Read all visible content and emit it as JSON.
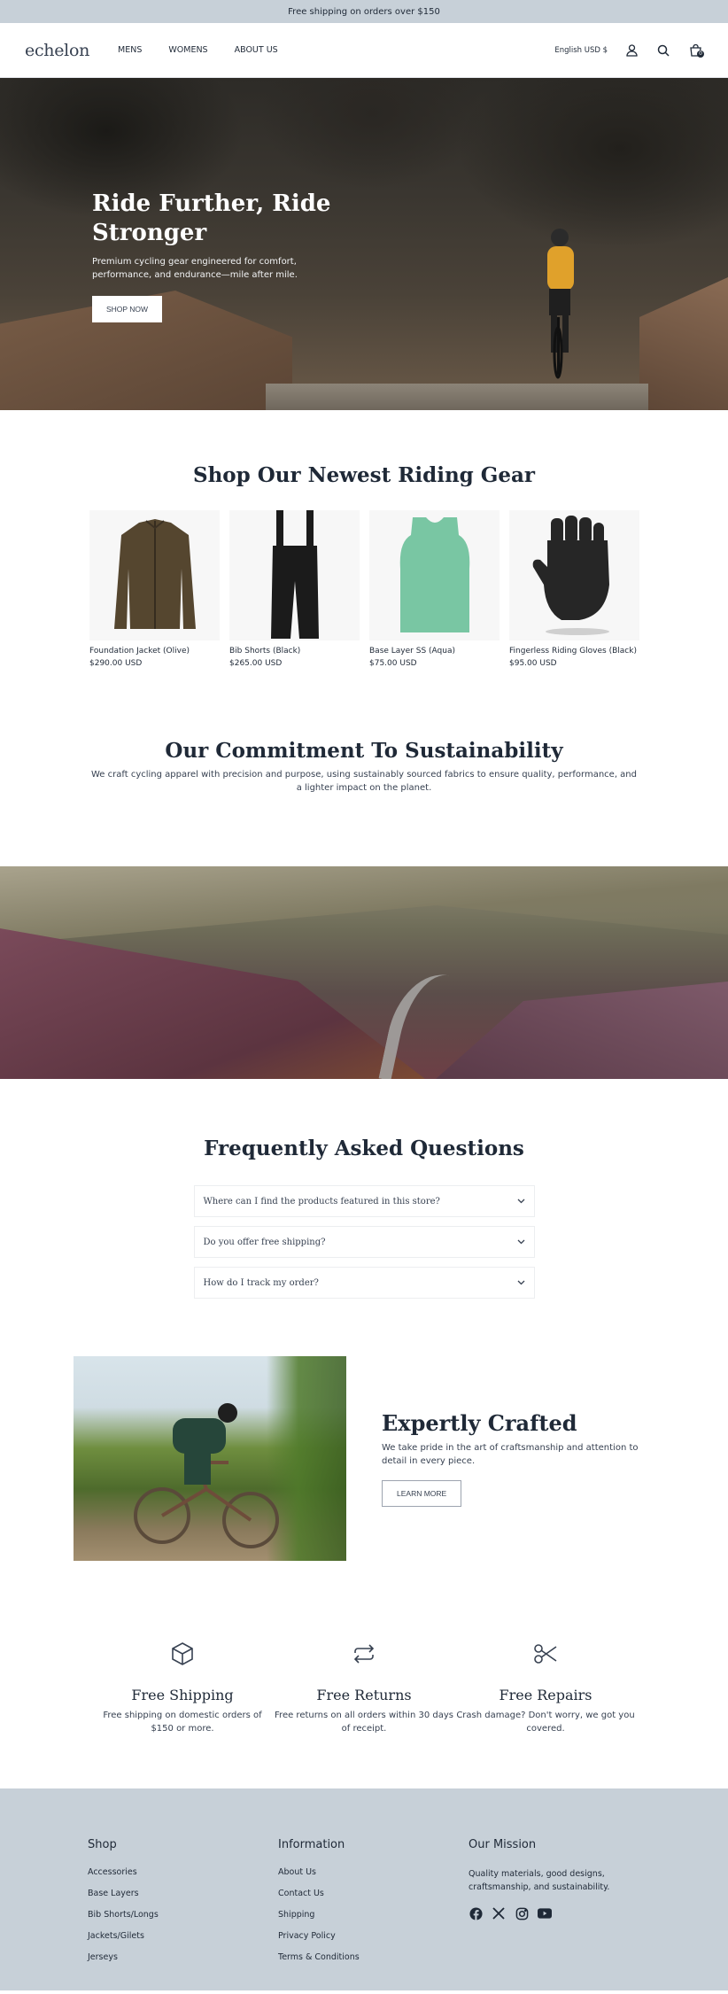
{
  "announcement": "Free shipping on orders over $150",
  "header": {
    "logo": "echelon",
    "nav": [
      "MENS",
      "WOMENS",
      "ABOUT US"
    ],
    "locale": "English USD $",
    "cart_count": "0"
  },
  "hero": {
    "title": "Ride Further, Ride Stronger",
    "subtitle": "Premium cycling gear engineered for comfort, performance, and endurance—mile after mile.",
    "button": "SHOP NOW"
  },
  "products": {
    "title": "Shop Our Newest Riding Gear",
    "items": [
      {
        "name": "Foundation Jacket (Olive)",
        "price": "$290.00 USD",
        "color": "#55462f"
      },
      {
        "name": "Bib Shorts (Black)",
        "price": "$265.00 USD",
        "color": "#1b1b1b"
      },
      {
        "name": "Base Layer SS (Aqua)",
        "price": "$75.00 USD",
        "color": "#79c6a3"
      },
      {
        "name": "Fingerless Riding Gloves (Black)",
        "price": "$95.00 USD",
        "color": "#262626"
      }
    ]
  },
  "sustainability": {
    "title": "Our Commitment To Sustainability",
    "text": "We craft cycling apparel with precision and purpose, using sustainably sourced fabrics to ensure quality, performance, and a lighter impact on the planet."
  },
  "faq": {
    "title": "Frequently Asked Questions",
    "items": [
      "Where can I find the products featured in this store?",
      "Do you offer free shipping?",
      "How do I track my order?"
    ]
  },
  "crafted": {
    "title": "Expertly Crafted",
    "text": "We take pride in the art of craftsmanship and attention to detail in every piece.",
    "button": "LEARN MORE"
  },
  "features": [
    {
      "icon": "box-icon",
      "title": "Free Shipping",
      "text": "Free shipping on domestic orders of $150 or more."
    },
    {
      "icon": "repeat-icon",
      "title": "Free Returns",
      "text": "Free returns on all orders within 30 days of receipt."
    },
    {
      "icon": "scissors-icon",
      "title": "Free Repairs",
      "text": "Crash damage? Don't worry, we got you covered."
    }
  ],
  "footer": {
    "shop_title": "Shop",
    "shop_links": [
      "Accessories",
      "Base Layers",
      "Bib Shorts/Longs",
      "Jackets/Gilets",
      "Jerseys"
    ],
    "info_title": "Information",
    "info_links": [
      "About Us",
      "Contact Us",
      "Shipping",
      "Privacy Policy",
      "Terms & Conditions"
    ],
    "mission_title": "Our Mission",
    "mission_text": "Quality materials, good designs, craftsmanship, and sustainability.",
    "socials": [
      "facebook-icon",
      "x-icon",
      "instagram-icon",
      "youtube-icon"
    ]
  }
}
